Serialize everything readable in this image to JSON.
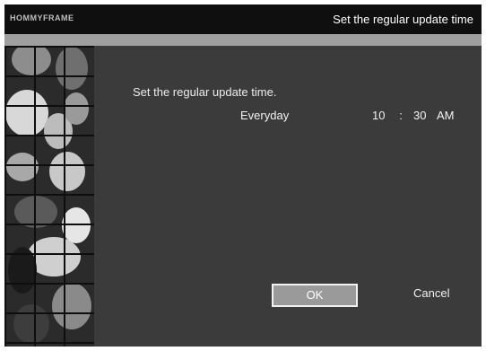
{
  "header": {
    "logo_text": "HOMMYFRAME",
    "title": "Set the regular update time"
  },
  "main": {
    "prompt": "Set the regular update time.",
    "schedule": "Everyday",
    "time": {
      "hour": "10",
      "separator": ":",
      "minute": "30",
      "meridiem": "AM"
    }
  },
  "buttons": {
    "ok": "OK",
    "cancel": "Cancel"
  },
  "colors": {
    "background": "#3a3a3a",
    "titlebar": "#0f0f0f",
    "stripe": "#9f9f9f",
    "ok_button": "#9a9a9a"
  }
}
